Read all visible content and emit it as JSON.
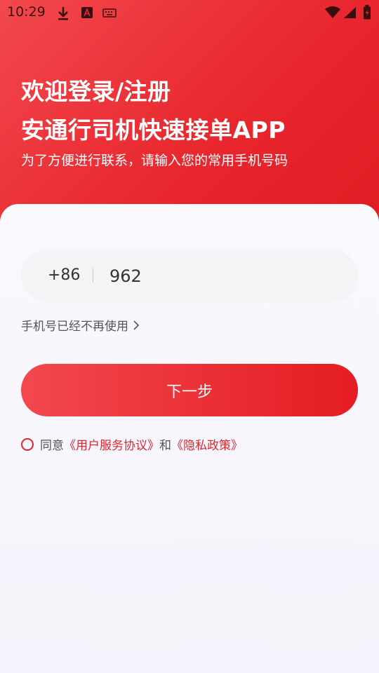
{
  "status": {
    "time": "10:29"
  },
  "header": {
    "title_line1": "欢迎登录/注册",
    "title_line2": "安通行司机快速接单APP",
    "subtitle": "为了方便进行联系，请输入您的常用手机号码"
  },
  "form": {
    "country_code": "+86",
    "phone_value": "962",
    "no_longer_label": "手机号已经不再使用",
    "next_label": "下一步"
  },
  "agreement": {
    "prefix": "同意",
    "user_agreement": "《用户服务协议》",
    "and": "和",
    "privacy_policy": "《隐私政策》"
  },
  "colors": {
    "accent": "#e8262d",
    "background": "#f4f4fb"
  }
}
